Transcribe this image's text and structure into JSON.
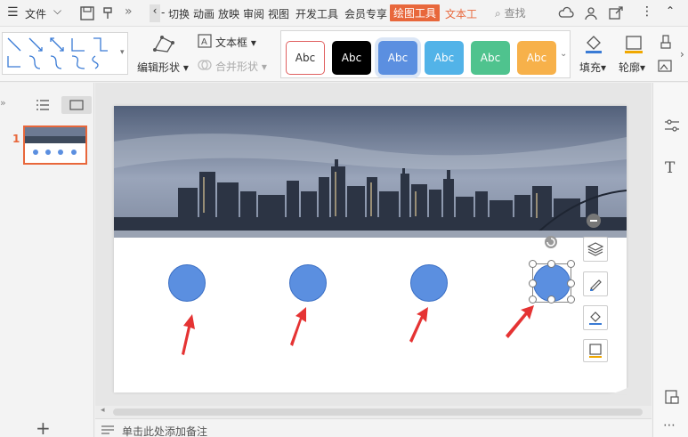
{
  "menubar": {
    "file_label": "文件",
    "tabs": [
      "切换",
      "动画",
      "放映",
      "审阅",
      "视图",
      "开发工具",
      "会员专享"
    ],
    "active_tab": "绘图工具",
    "orange_tab": "文本工",
    "search_label": "查找",
    "more_glyph": "»",
    "back_glyph": "‹",
    "dash_glyph": "-"
  },
  "ribbon": {
    "edit_shape_label": "编辑形状",
    "text_box_label": "文本框",
    "merge_shape_label": "合并形状",
    "style_sample_text": "Abc",
    "fill_label": "填充",
    "outline_label": "轮廓",
    "style_colors": [
      "#ffffff",
      "#000000",
      "#5b8fe0",
      "#52b3e8",
      "#4fc38e",
      "#f7b14a"
    ],
    "accent_color": "#e8673b"
  },
  "leftpanel": {
    "slide_number": "1",
    "add_glyph": "+"
  },
  "notes": {
    "placeholder": "单击此处添加备注"
  },
  "colors": {
    "circle": "#5b8fe0",
    "arrow": "#e53333"
  }
}
